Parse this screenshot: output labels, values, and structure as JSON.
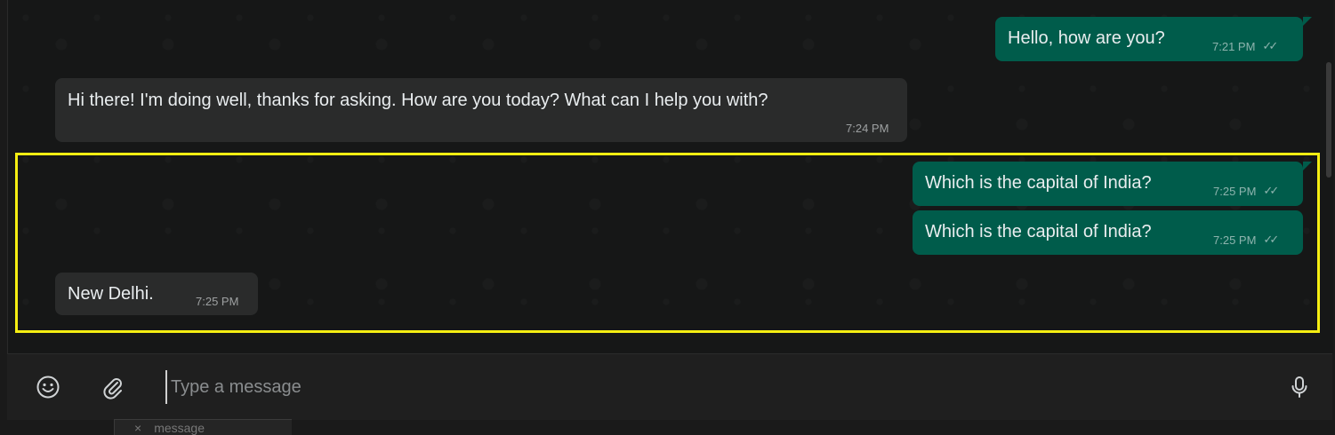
{
  "messages": [
    {
      "text": "Hello, how are you?",
      "time": "7:21 PM",
      "direction": "outgoing"
    },
    {
      "text": "Hi there! I'm doing well, thanks for asking. How are you today? What can I help you with?",
      "time": "7:24 PM",
      "direction": "incoming"
    },
    {
      "text": "Which is the capital of India?",
      "time": "7:25 PM",
      "direction": "outgoing"
    },
    {
      "text": "Which is the capital of India?",
      "time": "7:25 PM",
      "direction": "outgoing"
    },
    {
      "text": "New Delhi.",
      "time": "7:25 PM",
      "direction": "incoming"
    }
  ],
  "composer": {
    "placeholder": "Type a message",
    "emoji_icon": "emoji-icon",
    "attach_icon": "paperclip-icon",
    "mic_icon": "microphone-icon"
  },
  "underlay": {
    "text": "message"
  },
  "colors": {
    "outgoing_bubble": "#005c4b",
    "incoming_bubble": "#2a2b2b",
    "highlight": "#f5ee12"
  }
}
